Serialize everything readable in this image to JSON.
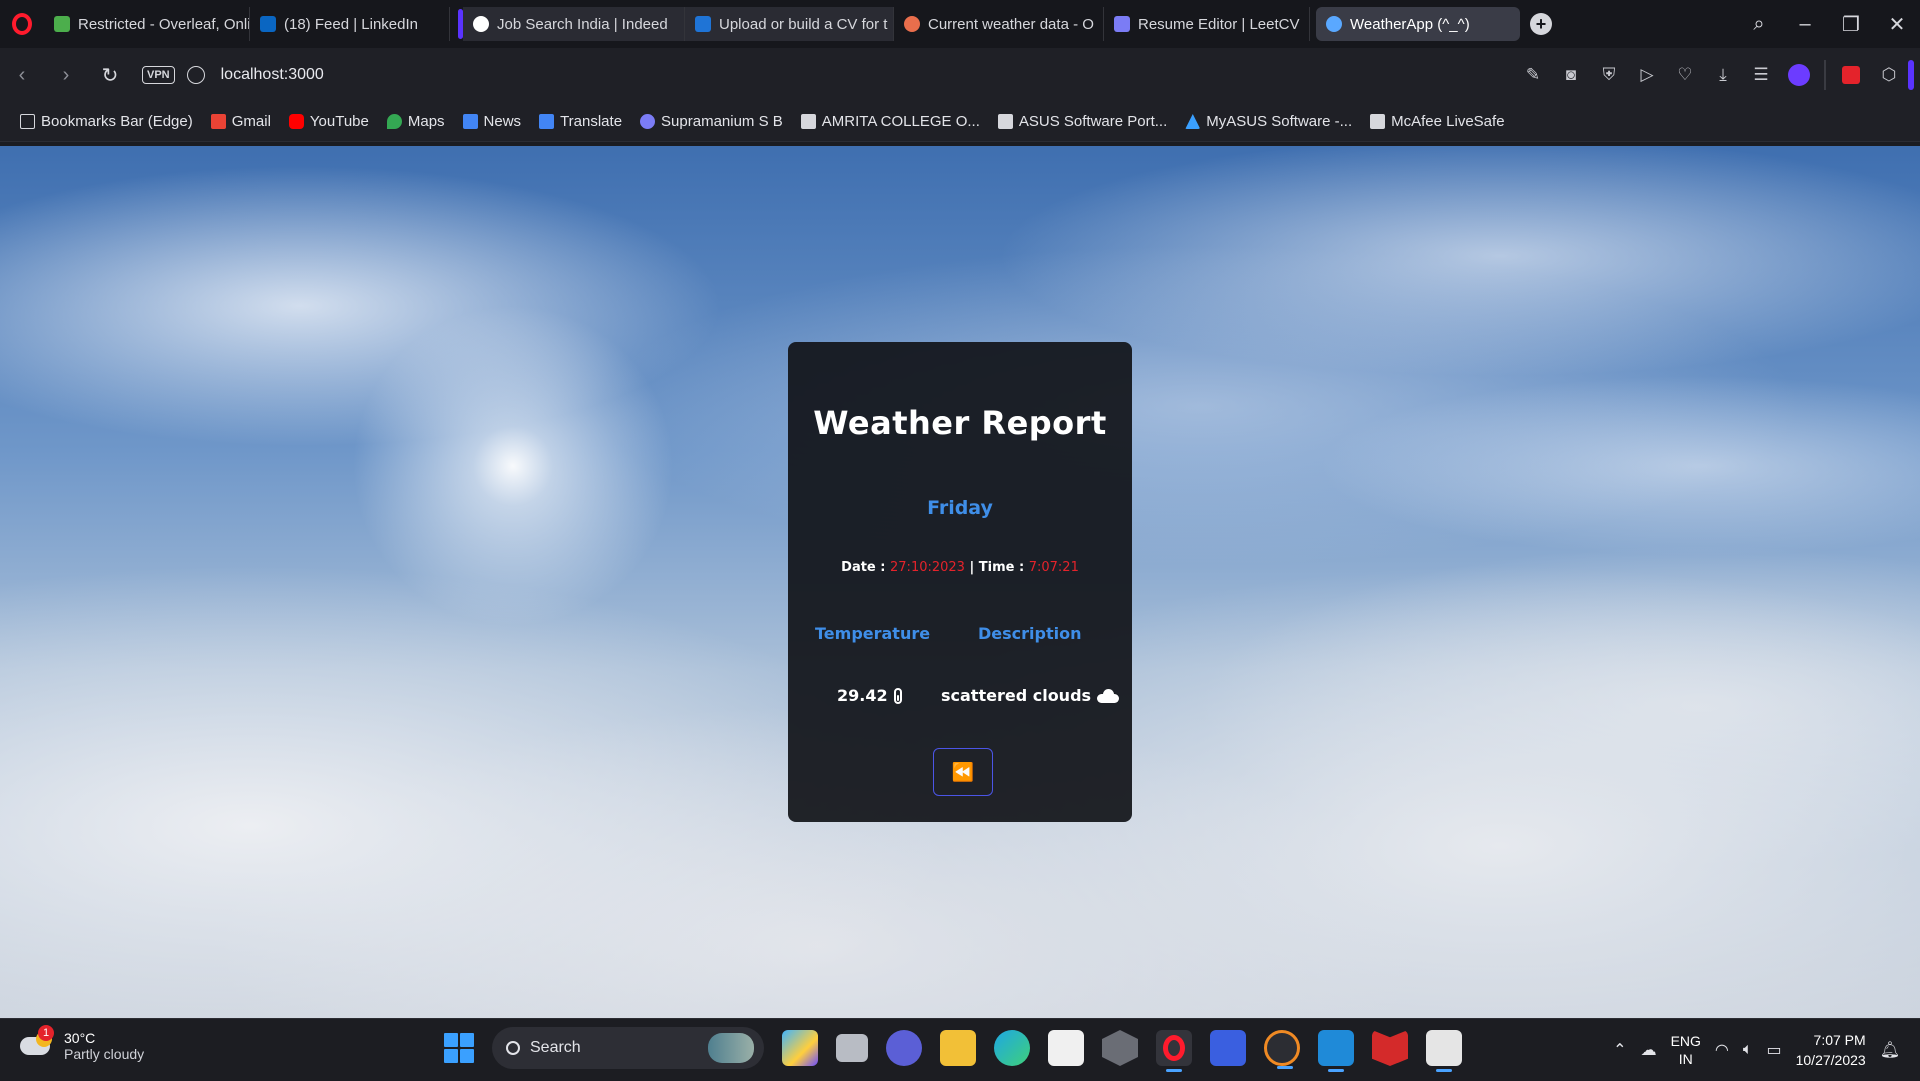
{
  "browser": {
    "tabs": [
      {
        "title": "Restricted - Overleaf, Onli",
        "favicon_color": "#4cae4c"
      },
      {
        "title": "(18) Feed | LinkedIn",
        "favicon_color": "#0a66c2"
      },
      {
        "title": "Job Search India | Indeed",
        "favicon_color": "#ffffff"
      },
      {
        "title": "Upload or build a CV for t",
        "favicon_color": "#1f74d6"
      },
      {
        "title": "Current weather data - O",
        "favicon_color": "#e96e4c"
      },
      {
        "title": "Resume Editor | LeetCV",
        "favicon_color": "#7b7cf5"
      },
      {
        "title": "WeatherApp (^_^)",
        "favicon_color": "#5aa8ff"
      }
    ],
    "url": "localhost:3000",
    "vpn_label": "VPN",
    "bookmarks": [
      {
        "label": "Bookmarks Bar (Edge)",
        "icon": "folder-icon",
        "color": "#d6d7dc"
      },
      {
        "label": "Gmail",
        "icon": "gmail-icon",
        "color": "#ea4335"
      },
      {
        "label": "YouTube",
        "icon": "youtube-icon",
        "color": "#ff0000"
      },
      {
        "label": "Maps",
        "icon": "maps-icon",
        "color": "#34a853"
      },
      {
        "label": "News",
        "icon": "news-icon",
        "color": "#4285f4"
      },
      {
        "label": "Translate",
        "icon": "translate-icon",
        "color": "#4285f4"
      },
      {
        "label": "Supramanium S B",
        "icon": "link-icon",
        "color": "#7b7cf5"
      },
      {
        "label": "AMRITA COLLEGE O...",
        "icon": "page-icon",
        "color": "#d6d7dc"
      },
      {
        "label": "ASUS Software Port...",
        "icon": "page-icon",
        "color": "#d6d7dc"
      },
      {
        "label": "MyASUS Software -...",
        "icon": "asus-icon",
        "color": "#3aa0ff"
      },
      {
        "label": "McAfee LiveSafe",
        "icon": "page-icon",
        "color": "#d6d7dc"
      }
    ]
  },
  "weather_card": {
    "title": "Weather Report",
    "day": "Friday",
    "date_label": "Date :",
    "date_value": "27:10:2023",
    "separator": "|",
    "time_label": "Time :",
    "time_value": "7:07:21",
    "temperature_header": "Temperature",
    "description_header": "Description",
    "temperature_value": "29.42",
    "description_value": "scattered clouds",
    "accent_color": "#3f8ee8",
    "highlight_color": "#e4232b"
  },
  "taskbar": {
    "weather_temp": "30°C",
    "weather_desc": "Partly cloudy",
    "weather_badge": "1",
    "search_placeholder": "Search",
    "lang_top": "ENG",
    "lang_bottom": "IN",
    "time": "7:07 PM",
    "date": "10/27/2023"
  }
}
